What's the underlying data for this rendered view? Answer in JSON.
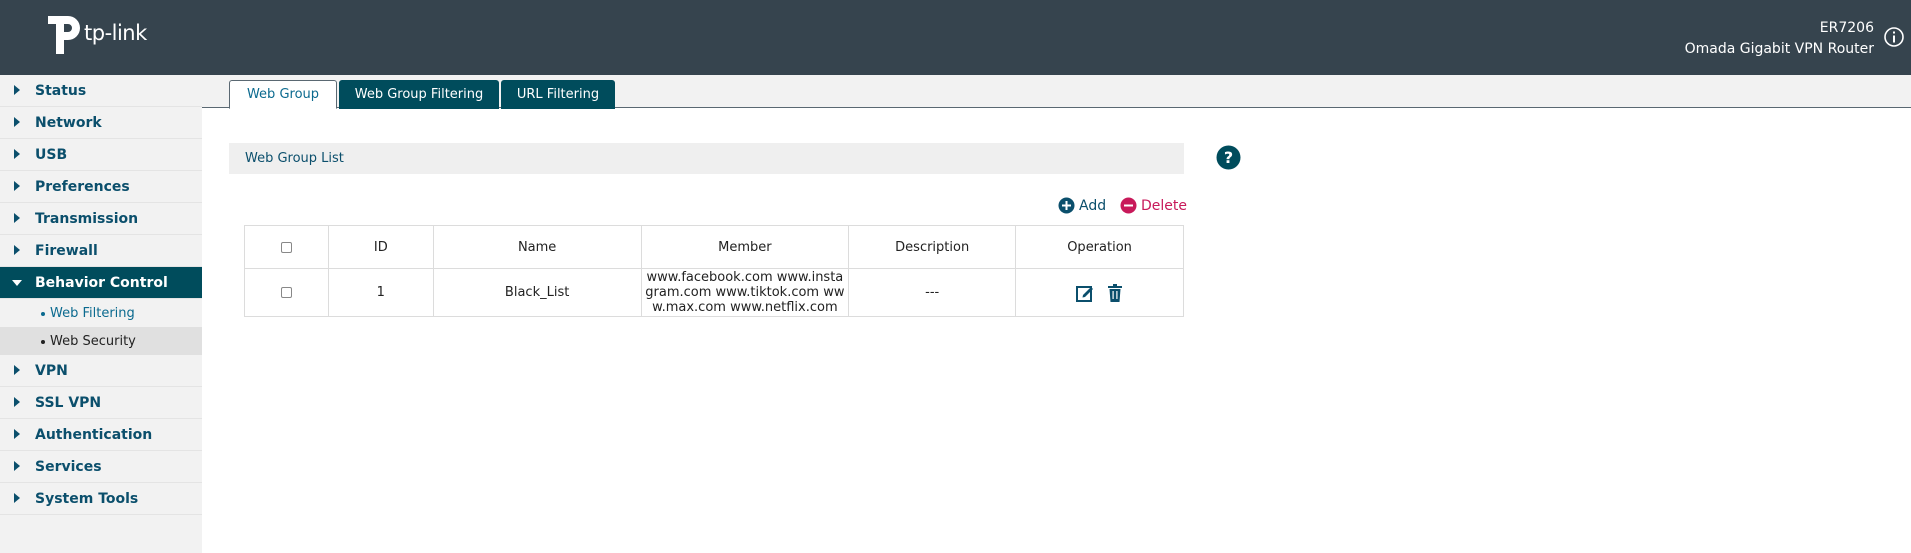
{
  "header": {
    "logo_text": "tp-link",
    "model": "ER7206",
    "product": "Omada Gigabit VPN Router",
    "brand_color": "#36444e"
  },
  "sidebar": {
    "items": [
      {
        "label": "Status"
      },
      {
        "label": "Network"
      },
      {
        "label": "USB"
      },
      {
        "label": "Preferences"
      },
      {
        "label": "Transmission"
      },
      {
        "label": "Firewall"
      },
      {
        "label": "Behavior Control",
        "active": true
      },
      {
        "label": "VPN"
      },
      {
        "label": "SSL VPN"
      },
      {
        "label": "Authentication"
      },
      {
        "label": "Services"
      },
      {
        "label": "System Tools"
      }
    ],
    "sub_items": [
      {
        "label": "Web Filtering"
      },
      {
        "label": "Web Security",
        "selected": true
      }
    ]
  },
  "tabs": [
    {
      "label": "Web Group",
      "active": true
    },
    {
      "label": "Web Group Filtering"
    },
    {
      "label": "URL Filtering"
    }
  ],
  "section": {
    "title": "Web Group List",
    "add_label": "Add",
    "delete_label": "Delete"
  },
  "table": {
    "columns": [
      "ID",
      "Name",
      "Member",
      "Description",
      "Operation"
    ],
    "rows": [
      {
        "id": "1",
        "name": "Black_List",
        "member": "www.facebook.com www.instagram.com www.tiktok.com www.max.com www.netflix.com",
        "description": "---"
      }
    ]
  },
  "colors": {
    "accent": "#004c5c",
    "link": "#0b6a8f",
    "delete": "#c8195a"
  }
}
